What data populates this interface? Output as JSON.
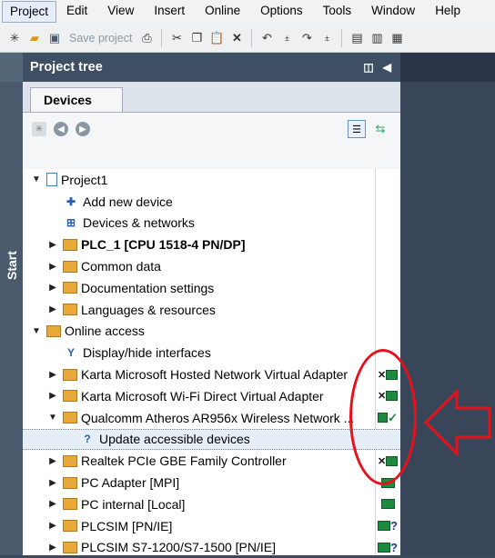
{
  "menu": [
    "Project",
    "Edit",
    "View",
    "Insert",
    "Online",
    "Options",
    "Tools",
    "Window",
    "Help"
  ],
  "toolbar": {
    "save_label": "Save project"
  },
  "startbar": {
    "label": "Start"
  },
  "tree_panel": {
    "title": "Project tree",
    "tab": "Devices"
  },
  "tree": [
    {
      "level": 0,
      "arrow": "▼",
      "icon": "project-icon",
      "label": "Project1",
      "bold": false
    },
    {
      "level": 1,
      "arrow": "",
      "icon": "add-device-icon",
      "label": "Add new device",
      "bold": false
    },
    {
      "level": 1,
      "arrow": "",
      "icon": "network-icon",
      "label": "Devices & networks",
      "bold": false
    },
    {
      "level": 1,
      "arrow": "▶",
      "icon": "plc-icon",
      "label": "PLC_1 [CPU 1518-4 PN/DP]",
      "bold": true
    },
    {
      "level": 1,
      "arrow": "▶",
      "icon": "common-data-icon",
      "label": "Common data",
      "bold": false
    },
    {
      "level": 1,
      "arrow": "▶",
      "icon": "documentation-icon",
      "label": "Documentation settings",
      "bold": false
    },
    {
      "level": 1,
      "arrow": "▶",
      "icon": "languages-icon",
      "label": "Languages & resources",
      "bold": false
    },
    {
      "level": 0,
      "arrow": "▼",
      "icon": "online-access-icon",
      "label": "Online access",
      "bold": false
    },
    {
      "level": 1,
      "arrow": "",
      "icon": "interface-icon",
      "label": "Display/hide interfaces",
      "bold": false
    },
    {
      "level": 1,
      "arrow": "▶",
      "icon": "adapter-icon",
      "label": "Karta Microsoft Hosted Network Virtual Adapter",
      "bold": false,
      "status": "net-x"
    },
    {
      "level": 1,
      "arrow": "▶",
      "icon": "adapter-icon",
      "label": "Karta Microsoft Wi-Fi Direct Virtual Adapter",
      "bold": false,
      "status": "net-x"
    },
    {
      "level": 1,
      "arrow": "▼",
      "icon": "adapter-icon",
      "label": "Qualcomm Atheros AR956x Wireless Network ...",
      "bold": false,
      "status": "net-ok"
    },
    {
      "level": 2,
      "arrow": "",
      "icon": "update-devices-icon",
      "label": "Update accessible devices",
      "bold": false,
      "selected": true
    },
    {
      "level": 1,
      "arrow": "▶",
      "icon": "adapter-icon",
      "label": "Realtek PCIe GBE Family Controller",
      "bold": false,
      "status": "net-x"
    },
    {
      "level": 1,
      "arrow": "▶",
      "icon": "adapter-icon",
      "label": "PC Adapter [MPI]",
      "bold": false,
      "status": "net"
    },
    {
      "level": 1,
      "arrow": "▶",
      "icon": "adapter-icon",
      "label": "PC internal [Local]",
      "bold": false,
      "status": "net"
    },
    {
      "level": 1,
      "arrow": "▶",
      "icon": "adapter-icon",
      "label": "PLCSIM [PN/IE]",
      "bold": false,
      "status": "net-q"
    },
    {
      "level": 1,
      "arrow": "▶",
      "icon": "adapter-icon",
      "label": "PLCSIM S7-1200/S7-1500 [PN/IE]",
      "bold": false,
      "status": "net-q"
    }
  ]
}
